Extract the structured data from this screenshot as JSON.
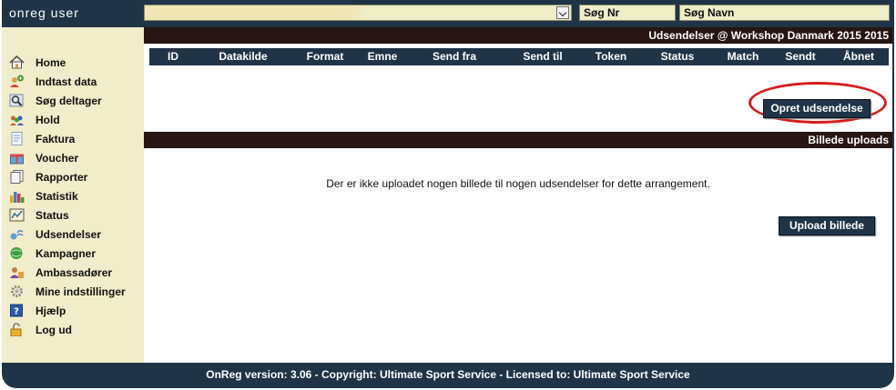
{
  "app": {
    "title": "onreg user"
  },
  "header": {
    "search_nr": "Søg Nr",
    "search_navn": "Søg Navn"
  },
  "sidebar": {
    "items": [
      {
        "label": "Home",
        "icon": "home-icon"
      },
      {
        "label": "Indtast data",
        "icon": "add-user-icon"
      },
      {
        "label": "Søg deltager",
        "icon": "search-person-icon"
      },
      {
        "label": "Hold",
        "icon": "team-icon"
      },
      {
        "label": "Faktura",
        "icon": "invoice-icon"
      },
      {
        "label": "Voucher",
        "icon": "gift-icon"
      },
      {
        "label": "Rapporter",
        "icon": "report-icon"
      },
      {
        "label": "Statistik",
        "icon": "bar-chart-icon"
      },
      {
        "label": "Status",
        "icon": "status-icon"
      },
      {
        "label": "Udsendelser",
        "icon": "broadcast-icon"
      },
      {
        "label": "Kampagner",
        "icon": "campaign-icon"
      },
      {
        "label": "Ambassadører",
        "icon": "ambassador-icon"
      },
      {
        "label": "Mine indstillinger",
        "icon": "settings-icon"
      },
      {
        "label": "Hjælp",
        "icon": "help-icon"
      },
      {
        "label": "Log ud",
        "icon": "lock-icon"
      }
    ]
  },
  "main": {
    "section_title": "Udsendelser @ Workshop Danmark 2015 2015",
    "table_columns": [
      "ID",
      "Datakilde",
      "Format",
      "Emne",
      "Send fra",
      "Send til",
      "Token",
      "Status",
      "Match",
      "Sendt",
      "Åbnet"
    ],
    "create_button": "Opret udsendelse",
    "uploads_title": "Billede uploads",
    "empty_message": "Der er ikke uploadet nogen billede til nogen udsendelser for dette arrangement.",
    "upload_button": "Upload billede"
  },
  "footer": {
    "text": "OnReg version: 3.06 - Copyright: Ultimate Sport Service - Licensed to: Ultimate Sport Service"
  },
  "colors": {
    "navy": "#1f3447",
    "sidebar_bg": "#f1ecc9",
    "dark_bar": "#261512",
    "highlight_circle": "#d41c1c"
  }
}
